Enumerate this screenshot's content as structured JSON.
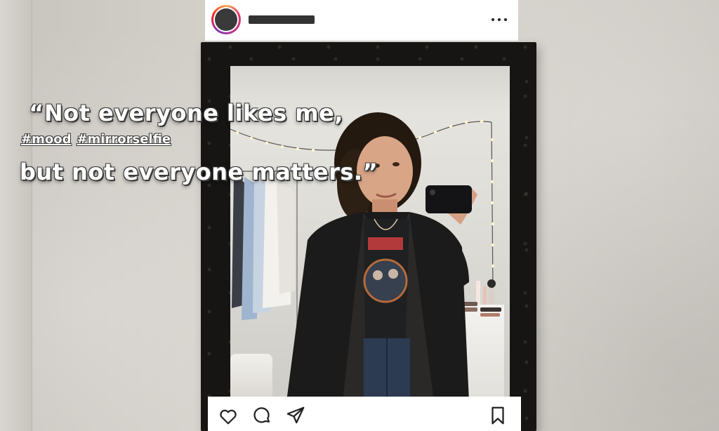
{
  "post": {
    "quote": {
      "line1": "“Not everyone likes me,",
      "line2": "but not everyone matters.”"
    },
    "hashtags": [
      "#mood",
      "#mirrorselfie"
    ],
    "header": {
      "more_icon": "more-horizontal-icon",
      "avatar_icon": "avatar"
    },
    "actions": {
      "like_icon": "heart-icon",
      "comment_icon": "comment-icon",
      "share_icon": "send-icon",
      "save_icon": "bookmark-icon"
    },
    "colors": {
      "card": "#ffffff",
      "icon": "#222222",
      "frame": "#161514"
    }
  }
}
